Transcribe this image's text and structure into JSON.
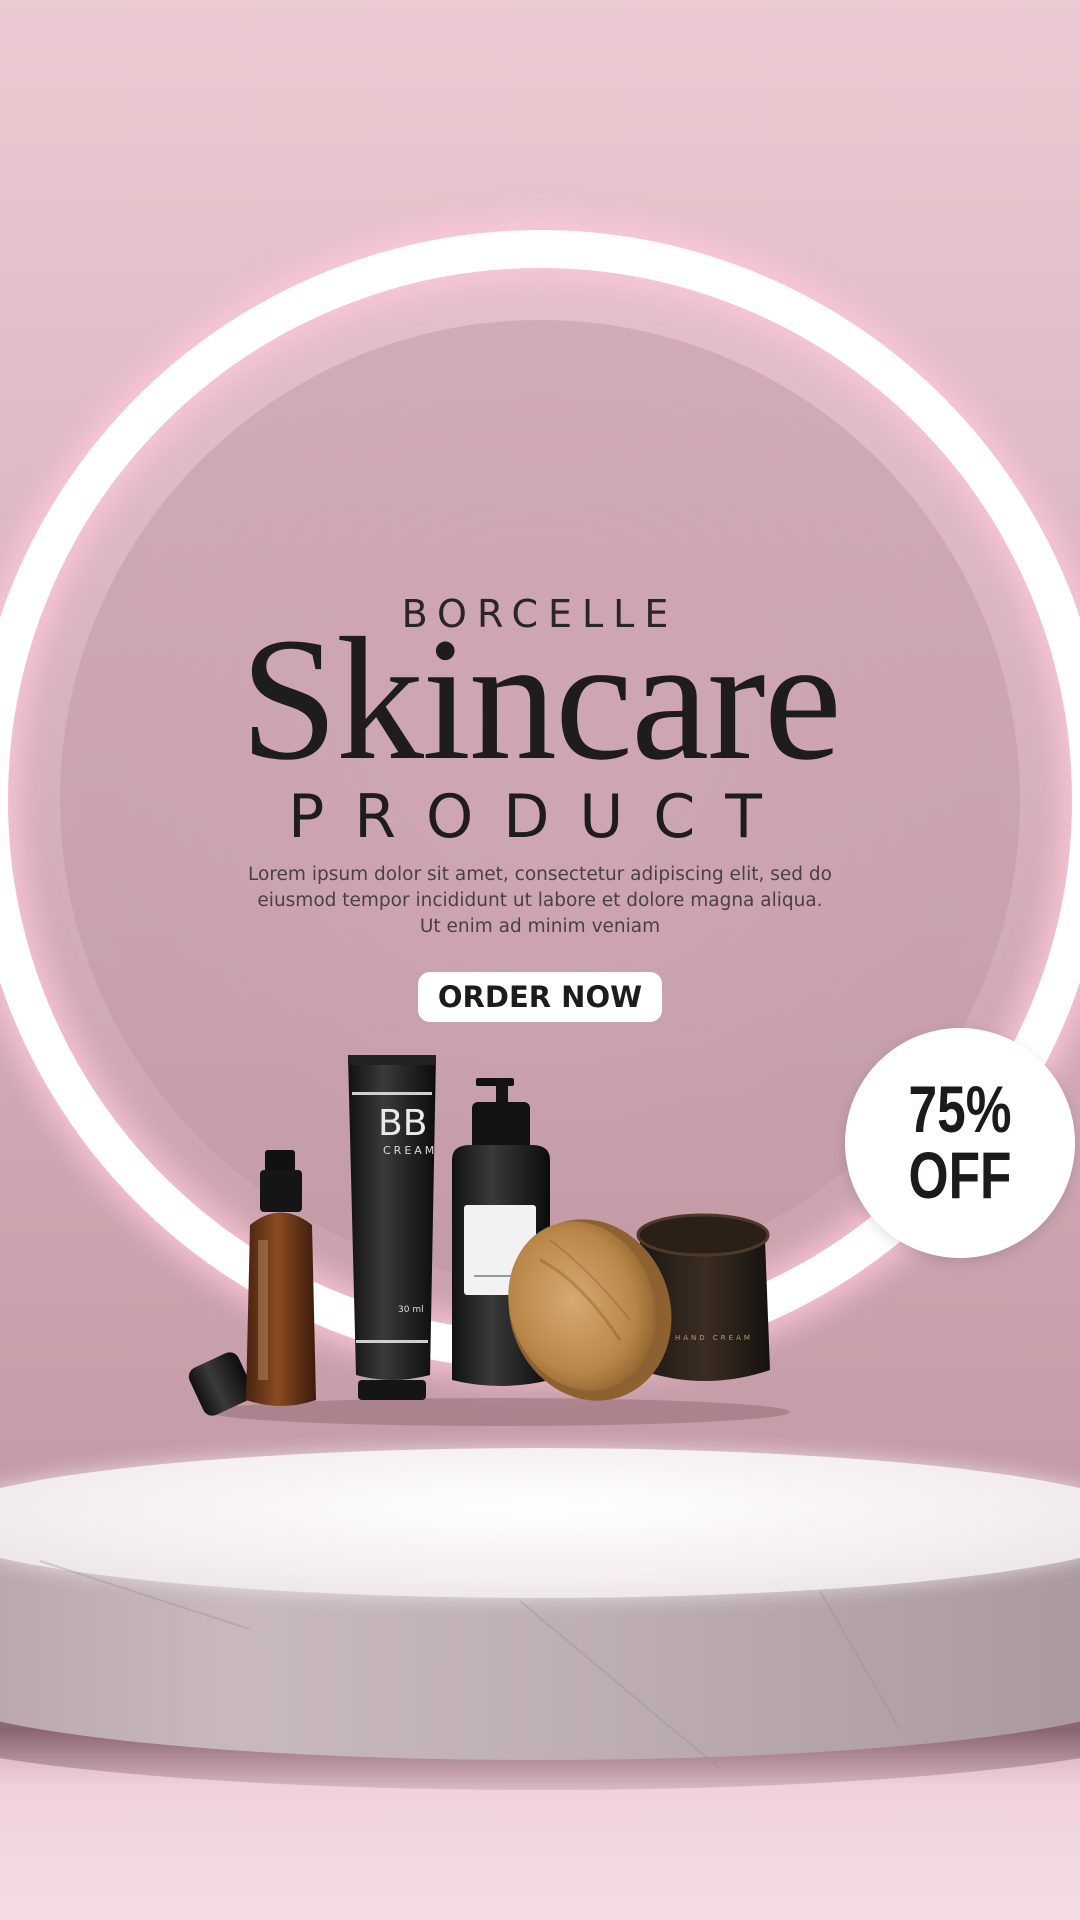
{
  "brand": "BORCELLE",
  "title": "Skincare",
  "subtitle": "PRODUCT",
  "description": [
    "Lorem ipsum dolor sit amet, consectetur adipiscing elit, sed do",
    "eiusmod tempor incididunt ut labore et dolore magna aliqua.",
    "Ut enim ad minim veniam"
  ],
  "cta": {
    "label": "ORDER NOW"
  },
  "badge": {
    "line1": "75%",
    "line2": "OFF"
  },
  "products": {
    "tube_label": "BB",
    "tube_sub": "CREAM",
    "tube_volume": "30 ml",
    "jar_label": "HAND CREAM"
  },
  "colors": {
    "background": "#d8b2bd",
    "ring": "#ffffff",
    "text": "#1f1c1d",
    "accent": "#ffffff"
  }
}
